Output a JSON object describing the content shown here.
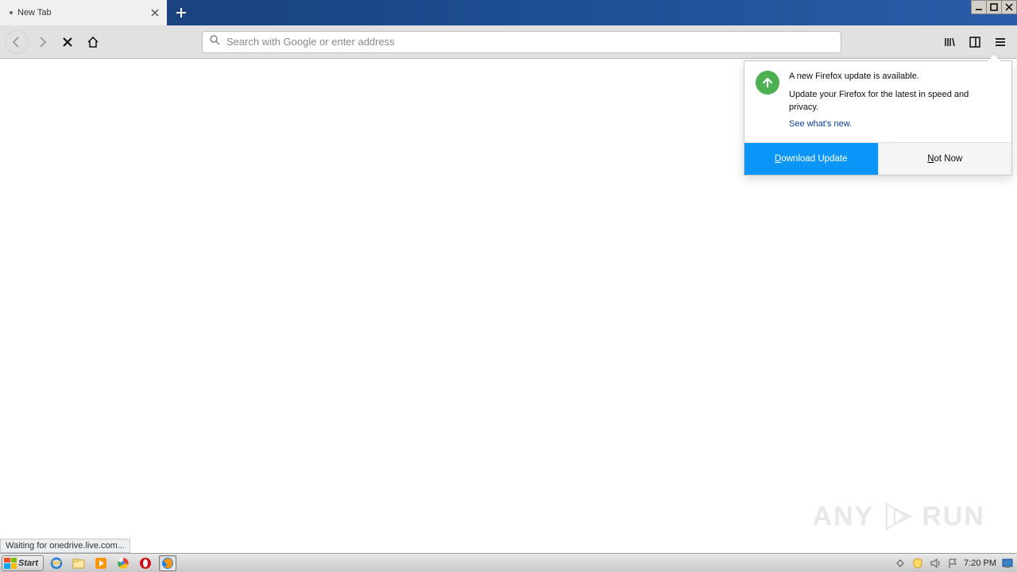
{
  "tab": {
    "title": "New Tab"
  },
  "nav": {
    "placeholder": "Search with Google or enter address"
  },
  "popup": {
    "heading": "A new Firefox update is available.",
    "desc": "Update your Firefox for the latest in speed and privacy.",
    "link": "See what's new.",
    "primary": "Download Update",
    "secondary": "Not Now"
  },
  "status": "Waiting for onedrive.live.com...",
  "taskbar": {
    "start": "Start",
    "clock": "7:20 PM"
  },
  "watermark": {
    "left": "ANY",
    "right": "RUN"
  }
}
